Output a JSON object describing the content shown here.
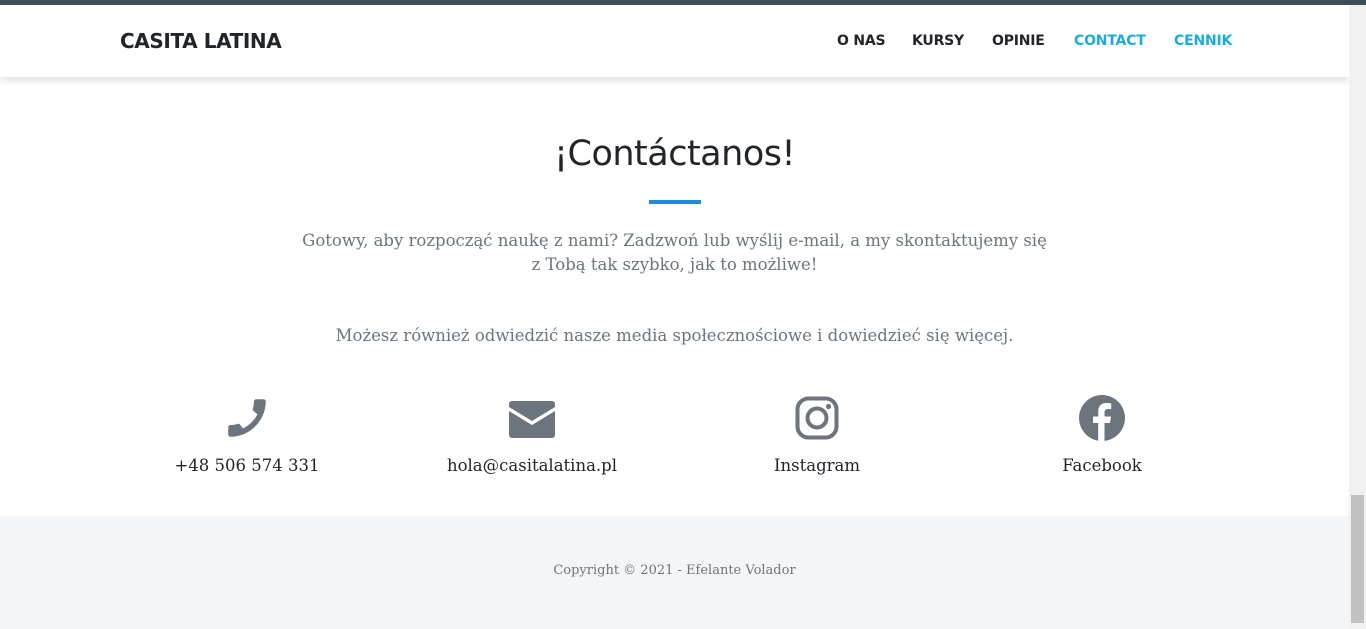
{
  "nav": {
    "brand": "CASITA LATINA",
    "items": [
      {
        "label": "O NAS"
      },
      {
        "label": "KURSY"
      },
      {
        "label": "OPINIE"
      },
      {
        "label": "CONTACT"
      },
      {
        "label": "CENNIK"
      }
    ],
    "highlight_color": "#1aabe3"
  },
  "contact": {
    "title": "¡Contáctanos!",
    "lead": "Gotowy, aby rozpocząć naukę z nami? Zadzwoń lub wyślij e-mail, a my skontaktujemy się z Tobą tak szybko, jak to możliwe!",
    "social_text": "Możesz również odwiedzić nasze media społecznościowe i dowiedzieć się więcej.",
    "items": [
      {
        "icon": "phone-icon",
        "label": "+48 506 574 331"
      },
      {
        "icon": "envelope-icon",
        "label": "hola@casitalatina.pl"
      },
      {
        "icon": "instagram-icon",
        "label": "Instagram"
      },
      {
        "icon": "facebook-icon",
        "label": "Facebook"
      }
    ],
    "icon_color": "#6c757d",
    "accent_color": "#1a8ed0"
  },
  "footer": {
    "copyright": "Copyright © 2021 - Efelante Volador"
  }
}
